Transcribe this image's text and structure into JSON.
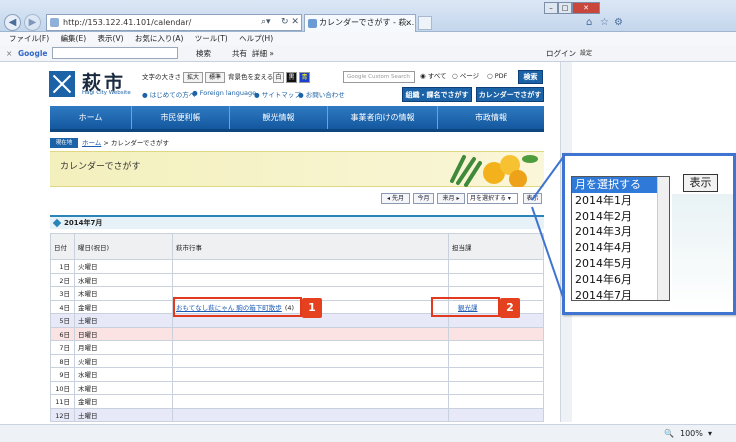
{
  "browser": {
    "address": "http://153.122.41.101/calendar/",
    "tab_title": "カレンダーでさがす - 萩...",
    "menu": [
      "ファイル(F)",
      "編集(E)",
      "表示(V)",
      "お気に入り(A)",
      "ツール(T)",
      "ヘルプ(H)"
    ],
    "google_label": "Google",
    "google_search_btn": "検索",
    "google_share": "共有",
    "google_more": "詳細 »",
    "login": "ログイン",
    "settings": "設定",
    "zoom": "100%"
  },
  "site": {
    "logo_text": "萩市",
    "logo_sub": "Hagi City Website",
    "font_size_label": "文字の大きさ",
    "font_enlarge": "拡大",
    "font_standard": "標準",
    "bg_color_label": "背景色を変える",
    "bg_white": "白",
    "bg_black": "黒",
    "bg_blue": "青",
    "links": [
      "はじめての方へ",
      "Foreign language",
      "サイトマップ",
      "お問い合わせ"
    ],
    "search_placeholder": "Google Custom Search",
    "search_scope": [
      "すべて",
      "ページ",
      "PDF"
    ],
    "search_button": "検索",
    "org_button": "組織・課名でさがす",
    "cal_button": "カレンダーでさがす",
    "gnav": [
      "ホーム",
      "市民便利帳",
      "観光情報",
      "事業者向けの情報",
      "市政情報"
    ],
    "crumb_tag": "現在地",
    "crumb_home": "ホーム",
    "crumb_current": "> カレンダーでさがす",
    "page_title": "カレンダーでさがす",
    "nav_buttons": [
      "◂ 先月",
      "今月",
      "来月 ▸"
    ],
    "month_select": "月を選択する",
    "show_button": "表示",
    "month_heading": "2014年7月",
    "table_headers": [
      "日付",
      "曜日(祝日)",
      "萩市行事",
      "担当課"
    ],
    "rows": [
      {
        "date": "1日",
        "dow": "火曜日",
        "type": ""
      },
      {
        "date": "2日",
        "dow": "水曜日",
        "type": ""
      },
      {
        "date": "3日",
        "dow": "木曜日",
        "type": ""
      },
      {
        "date": "4日",
        "dow": "金曜日",
        "type": "",
        "event": "おもてなし萩にゃん 駒の箱下町散歩",
        "event_suffix": "(4)",
        "dept": "観光課"
      },
      {
        "date": "5日",
        "dow": "土曜日",
        "type": "sat"
      },
      {
        "date": "6日",
        "dow": "日曜日",
        "type": "sun"
      },
      {
        "date": "7日",
        "dow": "月曜日",
        "type": ""
      },
      {
        "date": "8日",
        "dow": "火曜日",
        "type": ""
      },
      {
        "date": "9日",
        "dow": "水曜日",
        "type": ""
      },
      {
        "date": "10日",
        "dow": "木曜日",
        "type": ""
      },
      {
        "date": "11日",
        "dow": "金曜日",
        "type": ""
      },
      {
        "date": "12日",
        "dow": "土曜日",
        "type": "sat"
      }
    ]
  },
  "callouts": {
    "one": "1",
    "two": "2"
  },
  "popup": {
    "show_button": "表示",
    "options": [
      "月を選択する",
      "2014年1月",
      "2014年2月",
      "2014年3月",
      "2014年4月",
      "2014年5月",
      "2014年6月",
      "2014年7月"
    ],
    "selected_index": 0
  },
  "colors": {
    "brand_blue": "#1c62a6",
    "callout_red": "#e23a1e",
    "popup_border": "#3f74d1"
  }
}
